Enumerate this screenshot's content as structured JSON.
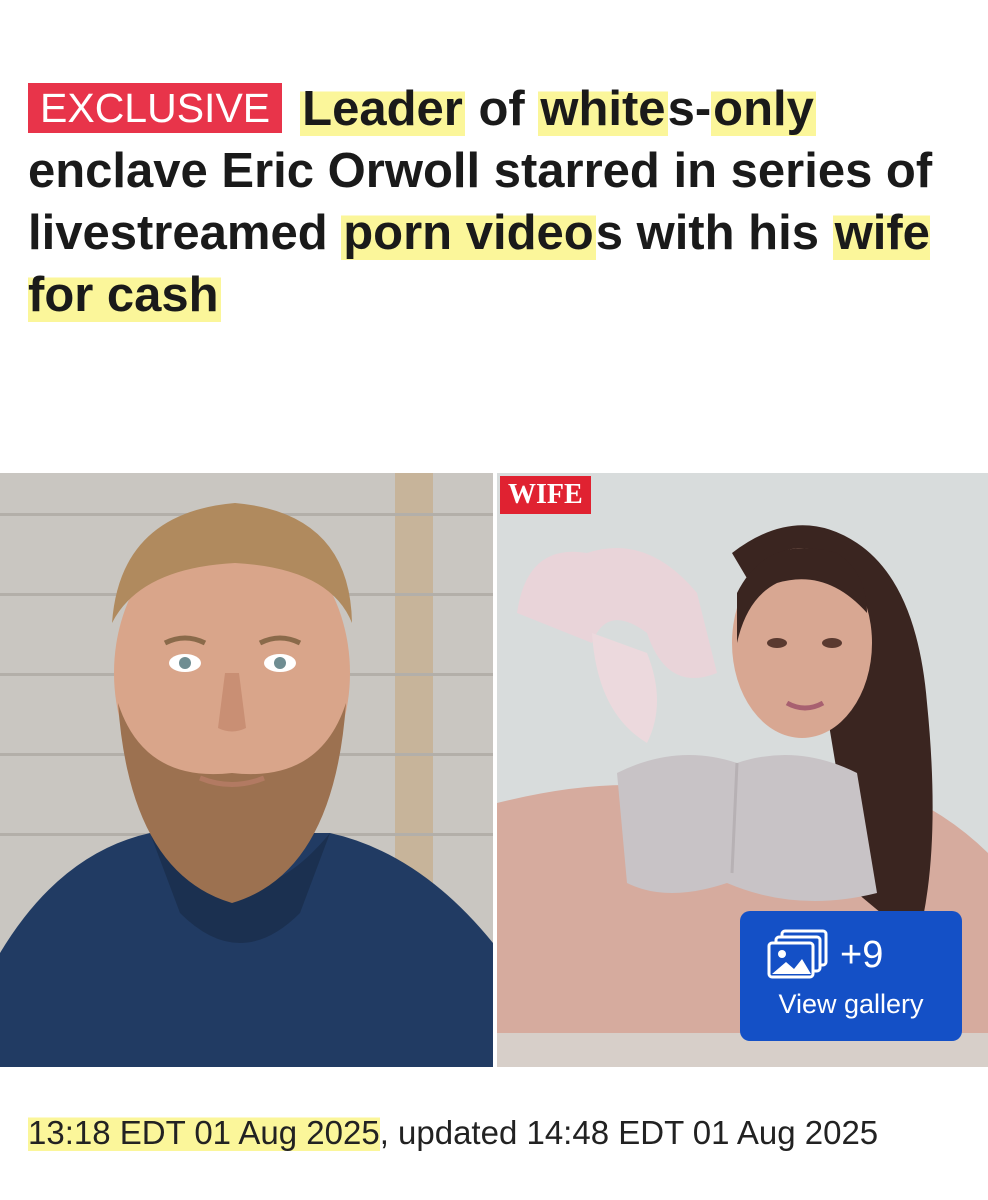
{
  "article": {
    "badge": "EXCLUSIVE",
    "headline_parts": {
      "p1": "Leader",
      "p2": " of ",
      "p3": "white",
      "p4": "s-",
      "p5": "only",
      "p6": " enclave Eric Orwoll starred in series of livestreamed ",
      "p7": "porn video",
      "p8": "s with his ",
      "p9": "wife for cash"
    },
    "photo_label": "WIFE",
    "gallery": {
      "count": "+9",
      "label": "View gallery"
    },
    "dateline": {
      "published": "13:18 EDT 01 Aug 2025",
      "rest": ", updated 14:48 EDT 01 Aug 2025"
    }
  },
  "colors": {
    "badge": "#e8344a",
    "highlight": "#fbf69a",
    "gallery_button": "#1450c6",
    "wife_label": "#e02231"
  },
  "icons": {
    "gallery": "photo-stack-icon"
  }
}
